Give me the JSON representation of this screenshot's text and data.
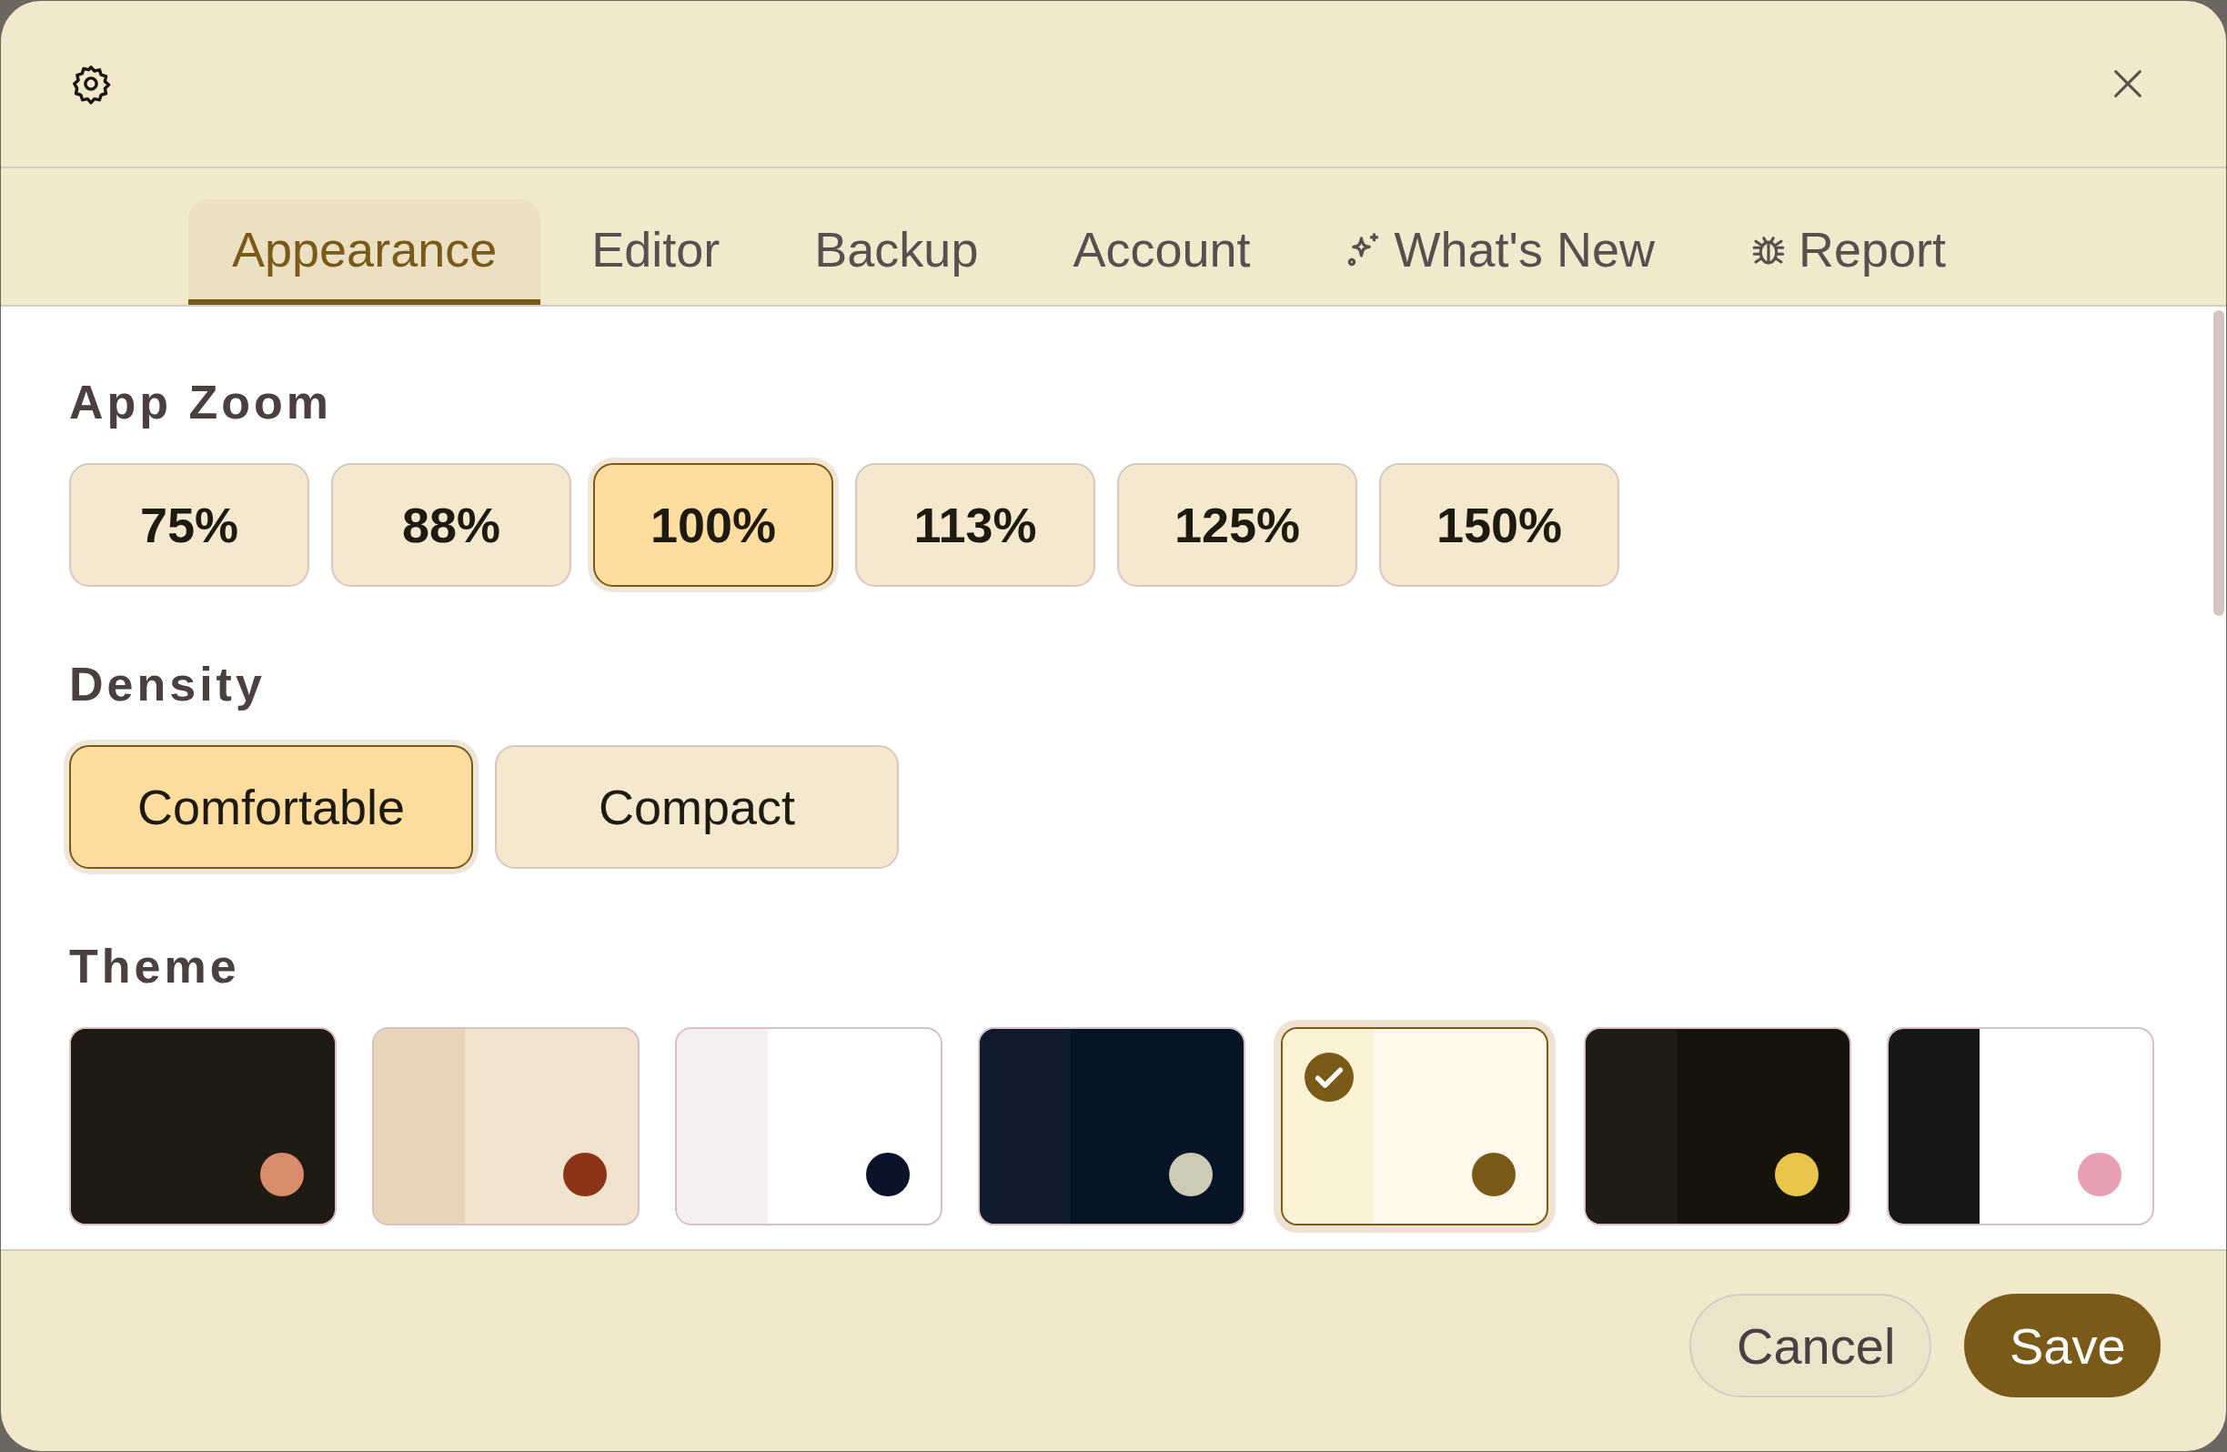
{
  "tabs": [
    {
      "label": "Appearance",
      "selected": true
    },
    {
      "label": "Editor",
      "selected": false
    },
    {
      "label": "Backup",
      "selected": false
    },
    {
      "label": "Account",
      "selected": false
    },
    {
      "label": "What's New",
      "selected": false
    },
    {
      "label": "Report",
      "selected": false
    }
  ],
  "app_zoom": {
    "title": "App Zoom",
    "options": [
      {
        "label": "75%",
        "selected": false
      },
      {
        "label": "88%",
        "selected": false
      },
      {
        "label": "100%",
        "selected": true
      },
      {
        "label": "113%",
        "selected": false
      },
      {
        "label": "125%",
        "selected": false
      },
      {
        "label": "150%",
        "selected": false
      }
    ]
  },
  "density": {
    "title": "Density",
    "options": [
      {
        "label": "Comfortable",
        "selected": true
      },
      {
        "label": "Compact",
        "selected": false
      }
    ]
  },
  "theme": {
    "title": "Theme",
    "options": [
      {
        "color": "#d98c6c",
        "selected": false
      },
      {
        "color": "#8b3418",
        "selected": false
      },
      {
        "color": "#0a1428",
        "selected": false
      },
      {
        "color": "#cdcbb6",
        "selected": false
      },
      {
        "color": "#7a5a18",
        "selected": true
      },
      {
        "color": "#e8c44a",
        "selected": false
      },
      {
        "color": "#e8a0b4",
        "selected": false
      }
    ]
  },
  "buttons": [
    {
      "label": "Cancel",
      "kind": "secondary"
    },
    {
      "label": "Save",
      "kind": "primary"
    }
  ]
}
